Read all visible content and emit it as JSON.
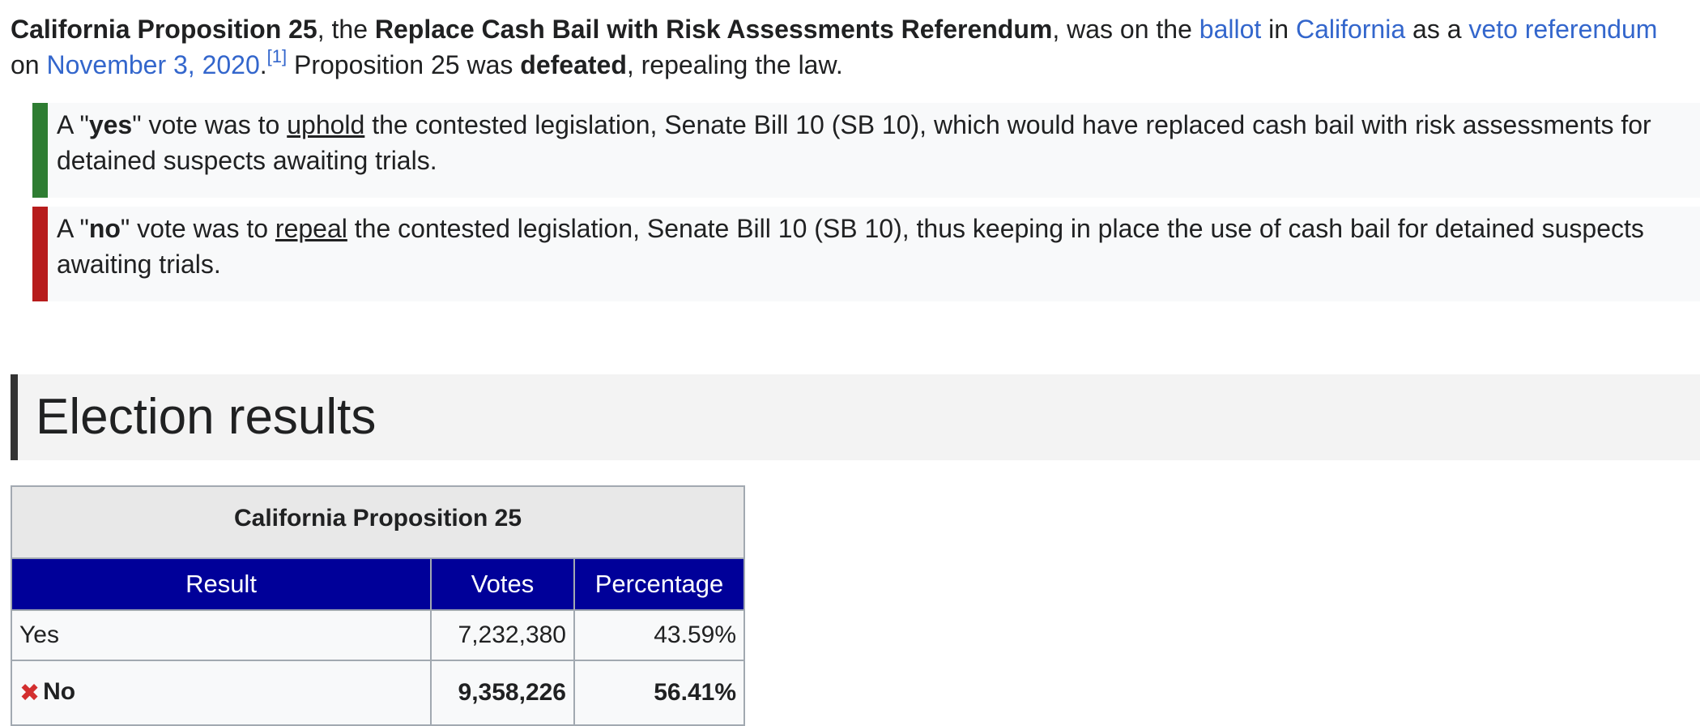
{
  "intro": {
    "p1_bold_name": "California Proposition 25",
    "p1_text1": ", the ",
    "p1_bold_title": "Replace Cash Bail with Risk Assessments Referendum",
    "p1_text2": ", was on the ",
    "link_ballot": "ballot",
    "p1_text3": " in ",
    "link_california": "California",
    "p1_text4": " as a ",
    "link_veto": "veto referendum",
    "p1_text5": " on ",
    "link_date": "November 3, 2020",
    "p1_text6": ".",
    "ref": "[1]",
    "p1_text7": " Proposition 25 was ",
    "p1_bold_defeated": "defeated",
    "p1_text8": ", repealing the law."
  },
  "yes_box": {
    "t1": "A \"",
    "bold": "yes",
    "t2": "\" vote was to ",
    "underlined": "uphold",
    "t3": " the contested legislation, Senate Bill 10 (SB 10), which would have replaced cash bail with risk assessments for detained suspects awaiting trials.",
    "bar_color": "#2e7d32"
  },
  "no_box": {
    "t1": "A \"",
    "bold": "no",
    "t2": "\" vote was to ",
    "underlined": "repeal",
    "t3": " the contested legislation, Senate Bill 10 (SB 10), thus keeping in place the use of cash bail for detained suspects awaiting trials.",
    "bar_color": "#b71c1c"
  },
  "section": {
    "heading": "Election results"
  },
  "results_table": {
    "caption": "California Proposition 25",
    "columns": [
      "Result",
      "Votes",
      "Percentage"
    ],
    "rows": [
      {
        "result": "Yes",
        "votes": "7,232,380",
        "percentage": "43.59%"
      },
      {
        "result": "No",
        "votes": "9,358,226",
        "percentage": "56.41%",
        "icon": "cross-x-icon"
      }
    ],
    "header_color": "#000099"
  }
}
